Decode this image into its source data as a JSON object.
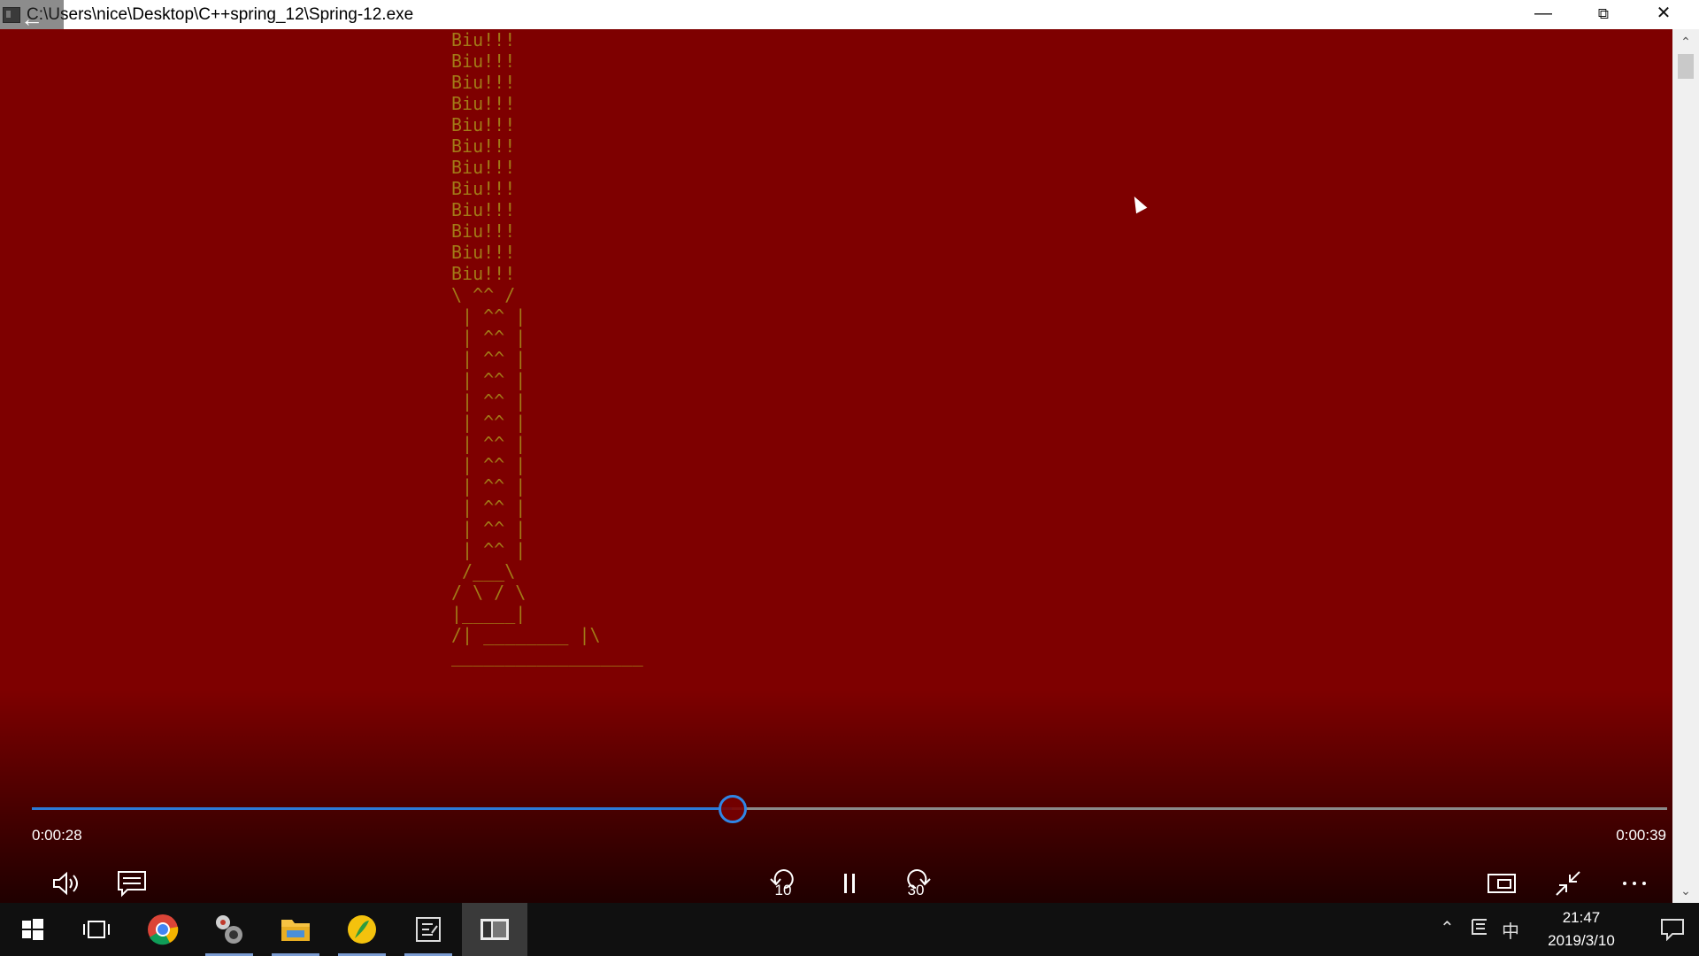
{
  "window": {
    "title": "C:\\Users\\nice\\Desktop\\C++spring_12\\Spring-12.exe",
    "icons": [
      "console-app-icon",
      "back-arrow-icon",
      "minimize-icon",
      "restore-icon",
      "close-icon"
    ]
  },
  "console": {
    "text": "Biu!!!\nBiu!!!\nBiu!!!\nBiu!!!\nBiu!!!\nBiu!!!\nBiu!!!\nBiu!!!\nBiu!!!\nBiu!!!\nBiu!!!\nBiu!!!\n\\ ^^ /\n | ^^ |\n | ^^ |\n | ^^ |\n | ^^ |\n | ^^ |\n | ^^ |\n | ^^ |\n | ^^ |\n | ^^ |\n | ^^ |\n | ^^ |\n | ^^ |\n /___\\\n/ \\ / \\\n|_____|\n/| ________ |\\\n__________________",
    "background_color": "#7e0000",
    "text_color": "#a27a17"
  },
  "player": {
    "elapsed": "0:00:28",
    "total": "0:00:39",
    "progress_fraction": 0.428,
    "skip_back": "10",
    "skip_forward": "30",
    "accent_color": "#2f86e6",
    "controls": [
      "volume-icon",
      "subtitles-icon",
      "skip-back-10-icon",
      "pause-icon",
      "skip-forward-30-icon",
      "mini-view-icon",
      "exit-fullscreen-icon",
      "more-options-icon"
    ]
  },
  "taskbar": {
    "apps": [
      "windows-start-icon",
      "task-view-icon",
      "chrome-icon",
      "app-icon",
      "file-explorer-icon",
      "app-icon",
      "app-icon",
      "console-app-icon"
    ],
    "tray": {
      "ime_label": "中",
      "time": "21:47",
      "date": "2019/3/10"
    }
  }
}
